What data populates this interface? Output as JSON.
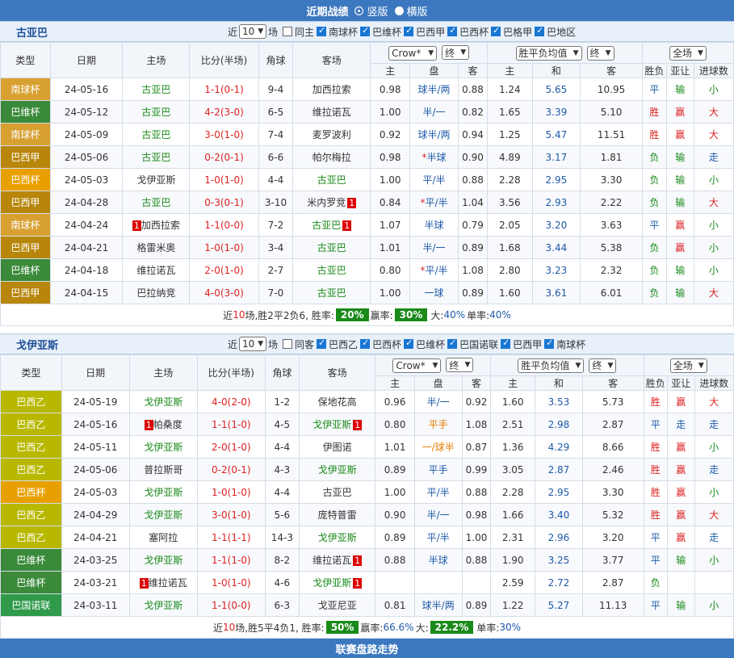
{
  "top_bar": {
    "title": "近期战绩",
    "opt1": "竖版",
    "opt2": "横版"
  },
  "sections": [
    {
      "team": "古亚巴",
      "recent_label": "近",
      "recent_count": "10",
      "unit": "场",
      "same_host": "同主",
      "leagues": [
        "南球杯",
        "巴维杯",
        "巴西甲",
        "巴西杯",
        "巴格甲",
        "巴地区"
      ],
      "headers": {
        "type": "类型",
        "date": "日期",
        "home": "主场",
        "score": "比分(半场)",
        "corner": "角球",
        "away": "客场",
        "bookmaker": "Crow*",
        "mode1": "终",
        "odds_type": "胜平负均值",
        "mode2": "终",
        "range": "全场",
        "sub": [
          "主",
          "盘",
          "客",
          "主",
          "和",
          "客"
        ],
        "wl": "胜负",
        "ah": "亚让",
        "ou": "进球数"
      },
      "rows": [
        {
          "type": "南球杯",
          "color": "#d8a030",
          "date": "24-05-16",
          "home": "古亚巴",
          "home_hl": true,
          "score": "1-1(0-1)",
          "corner": "9-4",
          "away": "加西拉索",
          "away_hl": false,
          "h": "0.98",
          "pan": "球半/两",
          "a": "0.88",
          "oh": "1.24",
          "od": "5.65",
          "oa": "10.95",
          "wl": "平",
          "ah": "输",
          "ou": "小"
        },
        {
          "type": "巴维杯",
          "color": "#3a8a3a",
          "date": "24-05-12",
          "home": "古亚巴",
          "home_hl": true,
          "score": "4-2(3-0)",
          "corner": "6-5",
          "away": "维拉诺瓦",
          "away_hl": false,
          "h": "1.00",
          "pan": "半/一",
          "a": "0.82",
          "oh": "1.65",
          "od": "3.39",
          "oa": "5.10",
          "wl": "胜",
          "ah": "赢",
          "ou": "大"
        },
        {
          "type": "南球杯",
          "color": "#d8a030",
          "date": "24-05-09",
          "home": "古亚巴",
          "home_hl": true,
          "score": "3-0(1-0)",
          "corner": "7-4",
          "away": "麦罗波利",
          "away_hl": false,
          "h": "0.92",
          "pan": "球半/两",
          "a": "0.94",
          "oh": "1.25",
          "od": "5.47",
          "oa": "11.51",
          "wl": "胜",
          "ah": "赢",
          "ou": "大"
        },
        {
          "type": "巴西甲",
          "color": "#b8860b",
          "date": "24-05-06",
          "home": "古亚巴",
          "home_hl": true,
          "score": "0-2(0-1)",
          "corner": "6-6",
          "away": "帕尔梅拉",
          "away_hl": false,
          "h": "0.98",
          "pan": "*半球",
          "a": "0.90",
          "oh": "4.89",
          "od": "3.17",
          "oa": "1.81",
          "wl": "负",
          "ah": "输",
          "ou": "走"
        },
        {
          "type": "巴西杯",
          "color": "#e8a000",
          "date": "24-05-03",
          "home": "戈伊亚斯",
          "home_hl": false,
          "score": "1-0(1-0)",
          "corner": "4-4",
          "away": "古亚巴",
          "away_hl": true,
          "h": "1.00",
          "pan": "平/半",
          "a": "0.88",
          "oh": "2.28",
          "od": "2.95",
          "oa": "3.30",
          "wl": "负",
          "ah": "输",
          "ou": "小"
        },
        {
          "type": "巴西甲",
          "color": "#b8860b",
          "date": "24-04-28",
          "home": "古亚巴",
          "home_hl": true,
          "score": "0-3(0-1)",
          "corner": "3-10",
          "away": "米内罗竞",
          "away_hl": false,
          "away_tag": "1",
          "h": "0.84",
          "pan": "*平/半",
          "a": "1.04",
          "oh": "3.56",
          "od": "2.93",
          "oa": "2.22",
          "wl": "负",
          "ah": "输",
          "ou": "大"
        },
        {
          "type": "南球杯",
          "color": "#d8a030",
          "date": "24-04-24",
          "home_tag": "1",
          "home": "加西拉索",
          "home_hl": false,
          "score": "1-1(0-0)",
          "corner": "7-2",
          "away": "古亚巴",
          "away_hl": true,
          "away_tag": "1",
          "h": "1.07",
          "pan": "半球",
          "a": "0.79",
          "oh": "2.05",
          "od": "3.20",
          "oa": "3.63",
          "wl": "平",
          "ah": "赢",
          "ou": "小"
        },
        {
          "type": "巴西甲",
          "color": "#b8860b",
          "date": "24-04-21",
          "home": "格雷米奥",
          "home_hl": false,
          "score": "1-0(1-0)",
          "corner": "3-4",
          "away": "古亚巴",
          "away_hl": true,
          "h": "1.01",
          "pan": "半/一",
          "a": "0.89",
          "oh": "1.68",
          "od": "3.44",
          "oa": "5.38",
          "wl": "负",
          "ah": "赢",
          "ou": "小"
        },
        {
          "type": "巴维杯",
          "color": "#3a8a3a",
          "date": "24-04-18",
          "home": "维拉诺瓦",
          "home_hl": false,
          "score": "2-0(1-0)",
          "corner": "2-7",
          "away": "古亚巴",
          "away_hl": true,
          "h": "0.80",
          "pan": "*平/半",
          "a": "1.08",
          "oh": "2.80",
          "od": "3.23",
          "oa": "2.32",
          "wl": "负",
          "ah": "输",
          "ou": "小"
        },
        {
          "type": "巴西甲",
          "color": "#b8860b",
          "date": "24-04-15",
          "home": "巴拉纳竞",
          "home_hl": false,
          "score": "4-0(3-0)",
          "corner": "7-0",
          "away": "古亚巴",
          "away_hl": true,
          "h": "1.00",
          "pan": "一球",
          "a": "0.89",
          "oh": "1.60",
          "od": "3.61",
          "oa": "6.01",
          "wl": "负",
          "ah": "输",
          "ou": "大"
        }
      ],
      "summary": {
        "pre": "近",
        "n": "10",
        "mid": "场,胜2平2负6, 胜率:",
        "win": "20%",
        "ying_label": "赢率:",
        "ying": "30%",
        "da_label": "大:",
        "da": "40%",
        "pan_label": "单率:",
        "pan": "40%"
      }
    },
    {
      "team": "戈伊亚斯",
      "recent_label": "近",
      "recent_count": "10",
      "unit": "场",
      "same_host": "同客",
      "leagues": [
        "巴西乙",
        "巴西杯",
        "巴维杯",
        "巴国诺联",
        "巴西甲",
        "南球杯"
      ],
      "headers": {
        "type": "类型",
        "date": "日期",
        "home": "主场",
        "score": "比分(半场)",
        "corner": "角球",
        "away": "客场",
        "bookmaker": "Crow*",
        "mode1": "终",
        "odds_type": "胜平负均值",
        "mode2": "终",
        "range": "全场",
        "sub": [
          "主",
          "盘",
          "客",
          "主",
          "和",
          "客"
        ],
        "wl": "胜负",
        "ah": "亚让",
        "ou": "进球数"
      },
      "rows": [
        {
          "type": "巴西乙",
          "color": "#b8b800",
          "date": "24-05-19",
          "home": "戈伊亚斯",
          "home_hl": true,
          "score": "4-0(2-0)",
          "corner": "1-2",
          "away": "保地花高",
          "away_hl": false,
          "h": "0.96",
          "pan": "半/一",
          "a": "0.92",
          "oh": "1.60",
          "od": "3.53",
          "oa": "5.73",
          "wl": "胜",
          "ah": "赢",
          "ou": "大"
        },
        {
          "type": "巴西乙",
          "color": "#b8b800",
          "date": "24-05-16",
          "home_tag": "1",
          "home": "帕桑度",
          "home_hl": false,
          "score": "1-1(1-0)",
          "corner": "4-5",
          "away": "戈伊亚斯",
          "away_hl": true,
          "away_tag": "1",
          "h": "0.80",
          "pan": "平手",
          "pan_orange": true,
          "a": "1.08",
          "oh": "2.51",
          "od": "2.98",
          "oa": "2.87",
          "wl": "平",
          "ah": "走",
          "ou": "走"
        },
        {
          "type": "巴西乙",
          "color": "#b8b800",
          "date": "24-05-11",
          "home": "戈伊亚斯",
          "home_hl": true,
          "score": "2-0(1-0)",
          "corner": "4-4",
          "away": "伊图诺",
          "away_hl": false,
          "h": "1.01",
          "pan": "一/球半",
          "pan_orange": true,
          "a": "0.87",
          "oh": "1.36",
          "od": "4.29",
          "oa": "8.66",
          "wl": "胜",
          "ah": "赢",
          "ou": "小"
        },
        {
          "type": "巴西乙",
          "color": "#b8b800",
          "date": "24-05-06",
          "home": "普拉斯哥",
          "home_hl": false,
          "score": "0-2(0-1)",
          "corner": "4-3",
          "away": "戈伊亚斯",
          "away_hl": true,
          "h": "0.89",
          "pan": "平手",
          "a": "0.99",
          "oh": "3.05",
          "od": "2.87",
          "oa": "2.46",
          "wl": "胜",
          "ah": "赢",
          "ou": "走"
        },
        {
          "type": "巴西杯",
          "color": "#e8a000",
          "date": "24-05-03",
          "home": "戈伊亚斯",
          "home_hl": true,
          "score": "1-0(1-0)",
          "corner": "4-4",
          "away": "古亚巴",
          "away_hl": false,
          "h": "1.00",
          "pan": "平/半",
          "a": "0.88",
          "oh": "2.28",
          "od": "2.95",
          "oa": "3.30",
          "wl": "胜",
          "ah": "赢",
          "ou": "小"
        },
        {
          "type": "巴西乙",
          "color": "#b8b800",
          "date": "24-04-29",
          "home": "戈伊亚斯",
          "home_hl": true,
          "score": "3-0(1-0)",
          "corner": "5-6",
          "away": "庞特普雷",
          "away_hl": false,
          "h": "0.90",
          "pan": "半/一",
          "a": "0.98",
          "oh": "1.66",
          "od": "3.40",
          "oa": "5.32",
          "wl": "胜",
          "ah": "赢",
          "ou": "大"
        },
        {
          "type": "巴西乙",
          "color": "#b8b800",
          "date": "24-04-21",
          "home": "塞阿拉",
          "home_hl": false,
          "score": "1-1(1-1)",
          "corner": "14-3",
          "away": "戈伊亚斯",
          "away_hl": true,
          "h": "0.89",
          "pan": "平/半",
          "a": "1.00",
          "oh": "2.31",
          "od": "2.96",
          "oa": "3.20",
          "wl": "平",
          "ah": "赢",
          "ou": "走"
        },
        {
          "type": "巴维杯",
          "color": "#3a8a3a",
          "date": "24-03-25",
          "home": "戈伊亚斯",
          "home_hl": true,
          "score": "1-1(1-0)",
          "corner": "8-2",
          "away": "维拉诺瓦",
          "away_hl": false,
          "away_tag": "1",
          "h": "0.88",
          "pan": "半球",
          "a": "0.88",
          "oh": "1.90",
          "od": "3.25",
          "oa": "3.77",
          "wl": "平",
          "ah": "输",
          "ou": "小"
        },
        {
          "type": "巴维杯",
          "color": "#3a8a3a",
          "date": "24-03-21",
          "home_tag": "1",
          "home": "维拉诺瓦",
          "home_hl": false,
          "score": "1-0(1-0)",
          "corner": "4-6",
          "away": "戈伊亚斯",
          "away_hl": true,
          "away_tag": "1",
          "h": "",
          "pan": "",
          "a": "",
          "oh": "2.59",
          "od": "2.72",
          "oa": "2.87",
          "wl": "负",
          "ah": "",
          "ou": ""
        },
        {
          "type": "巴国诺联",
          "color": "#2e9a4a",
          "date": "24-03-11",
          "home": "戈伊亚斯",
          "home_hl": true,
          "score": "1-1(0-0)",
          "corner": "6-3",
          "away": "戈亚尼亚",
          "away_hl": false,
          "h": "0.81",
          "pan": "球半/两",
          "a": "0.89",
          "oh": "1.22",
          "od": "5.27",
          "oa": "11.13",
          "wl": "平",
          "ah": "输",
          "ou": "小"
        }
      ],
      "summary": {
        "pre": "近",
        "n": "10",
        "mid": "场,胜5平4负1, 胜率:",
        "win": "50%",
        "ying_label": "赢率:",
        "ying": "66.6%",
        "da_label": "大:",
        "da": "22.2%",
        "pan_label": "单率:",
        "pan": "30%"
      }
    }
  ],
  "footer": {
    "title": "联赛盘路走势"
  }
}
